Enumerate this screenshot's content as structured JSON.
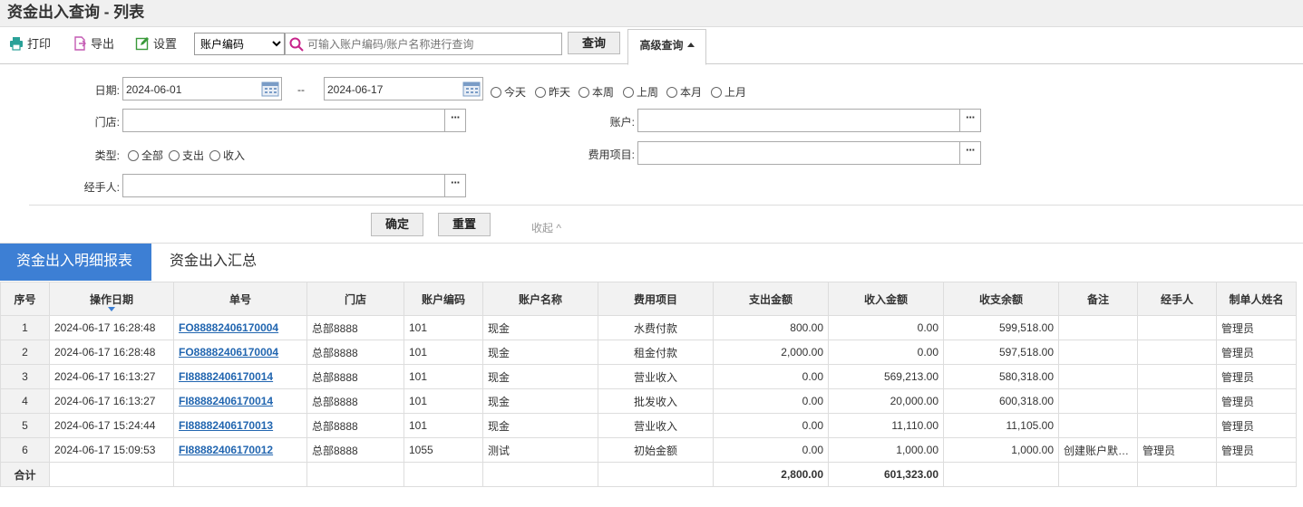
{
  "title": "资金出入查询 - 列表",
  "toolbar": {
    "print_label": "打印",
    "export_label": "导出",
    "settings_label": "设置",
    "account_select_value": "账户编码",
    "search_placeholder": "可输入账户编码/账户名称进行查询",
    "query_label": "查询",
    "advanced_label": "高级查询"
  },
  "filters": {
    "date_label": "日期:",
    "date_from": "2024-06-01",
    "date_sep": "--",
    "date_to": "2024-06-17",
    "quick_dates": [
      "今天",
      "昨天",
      "本周",
      "上周",
      "本月",
      "上月"
    ],
    "store_label": "门店:",
    "account_label": "账户:",
    "type_label": "类型:",
    "types": [
      "全部",
      "支出",
      "收入"
    ],
    "expense_label": "费用项目:",
    "handler_label": "经手人:",
    "confirm_label": "确定",
    "reset_label": "重置",
    "collapse_label": "收起"
  },
  "tabs": [
    "资金出入明细报表",
    "资金出入汇总"
  ],
  "table": {
    "headers": [
      "序号",
      "操作日期",
      "单号",
      "门店",
      "账户编码",
      "账户名称",
      "费用项目",
      "支出金额",
      "收入金额",
      "收支余额",
      "备注",
      "经手人",
      "制单人姓名"
    ],
    "rows": [
      [
        "1",
        "2024-06-17 16:28:48",
        "FO88882406170004",
        "总部8888",
        "101",
        "现金",
        "水费付款",
        "800.00",
        "0.00",
        "599,518.00",
        "",
        "",
        "管理员"
      ],
      [
        "2",
        "2024-06-17 16:28:48",
        "FO88882406170004",
        "总部8888",
        "101",
        "现金",
        "租金付款",
        "2,000.00",
        "0.00",
        "597,518.00",
        "",
        "",
        "管理员"
      ],
      [
        "3",
        "2024-06-17 16:13:27",
        "FI88882406170014",
        "总部8888",
        "101",
        "现金",
        "营业收入",
        "0.00",
        "569,213.00",
        "580,318.00",
        "",
        "",
        "管理员"
      ],
      [
        "4",
        "2024-06-17 16:13:27",
        "FI88882406170014",
        "总部8888",
        "101",
        "现金",
        "批发收入",
        "0.00",
        "20,000.00",
        "600,318.00",
        "",
        "",
        "管理员"
      ],
      [
        "5",
        "2024-06-17 15:24:44",
        "FI88882406170013",
        "总部8888",
        "101",
        "现金",
        "营业收入",
        "0.00",
        "11,110.00",
        "11,105.00",
        "",
        "",
        "管理员"
      ],
      [
        "6",
        "2024-06-17 15:09:53",
        "FI88882406170012",
        "总部8888",
        "1055",
        "测试",
        "初始金额",
        "0.00",
        "1,000.00",
        "1,000.00",
        "创建账户默认值",
        "管理员",
        "管理员"
      ]
    ],
    "total_label": "合计",
    "total_expense": "2,800.00",
    "total_income": "601,323.00"
  },
  "colors": {
    "accent": "#3d7fd4",
    "link": "#2266b0"
  }
}
